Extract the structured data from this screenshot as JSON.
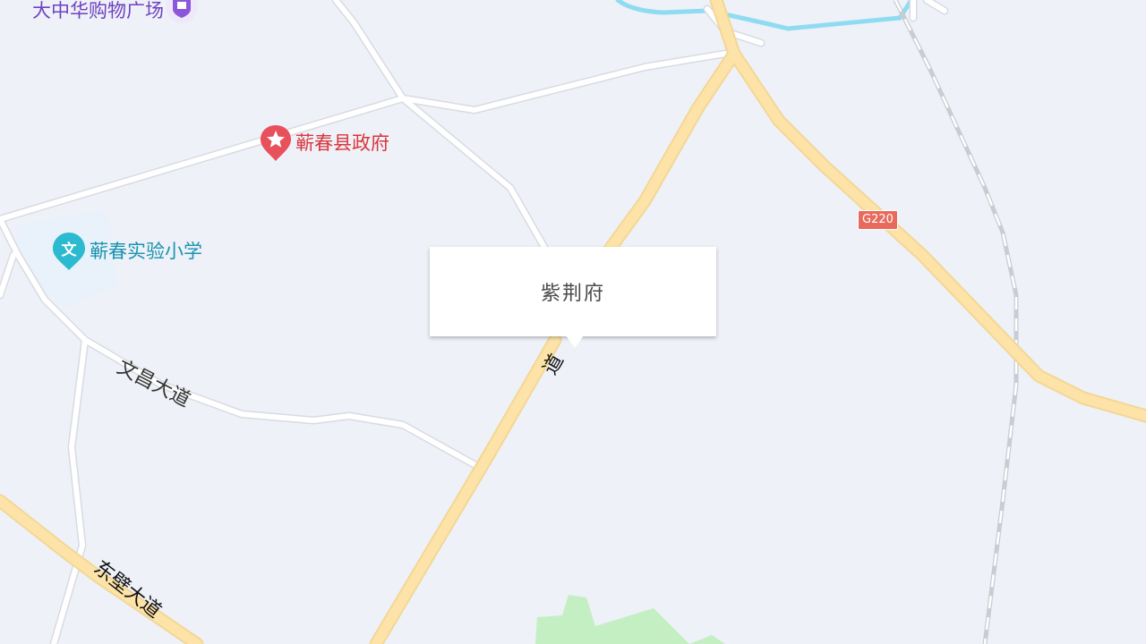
{
  "map": {
    "pois": [
      {
        "name": "大中华购物广场",
        "icon": "shopping-bag-icon",
        "color": "#6f42c1"
      },
      {
        "name": "蕲春县政府",
        "icon": "government-star-icon",
        "color": "#d9363e"
      },
      {
        "name": "蕲春实验小学",
        "icon": "school-icon",
        "color": "#1a93b0"
      }
    ],
    "roads": [
      {
        "name": "文昌大道"
      },
      {
        "name": "东壁大道"
      },
      {
        "name": "道"
      }
    ],
    "route_shield": "G220",
    "colors": {
      "background": "#eef1f7",
      "major_road": "#fde3a7",
      "minor_road": "#ffffff",
      "river": "#8fdcf2",
      "park": "#c4efc3",
      "railway": "#c9ccd2"
    }
  },
  "popup": {
    "title": "紫荆府"
  }
}
